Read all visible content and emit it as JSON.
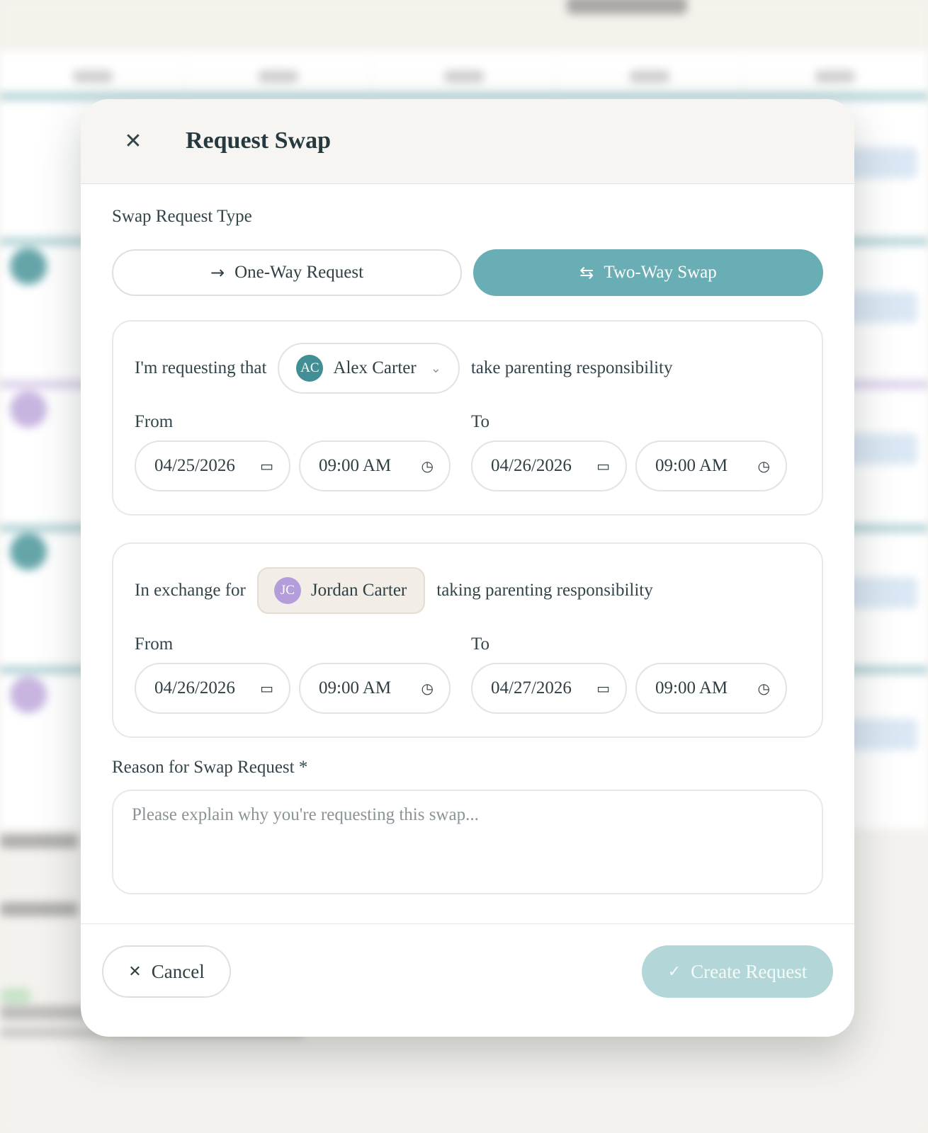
{
  "modal": {
    "title": "Request Swap",
    "close_icon": "close-icon",
    "type_label": "Swap Request Type",
    "types": [
      {
        "label": "One-Way Request",
        "icon": "arrow-right-icon",
        "active": false
      },
      {
        "label": "Two-Way Swap",
        "icon": "swap-arrows-icon",
        "active": true
      }
    ],
    "request": {
      "prefix": "I'm requesting that",
      "person_name": "Alex Carter",
      "person_initials": "AC",
      "suffix": "take parenting responsibility",
      "from_label": "From",
      "to_label": "To",
      "from_date": "04/25/2026",
      "from_time": "09:00 AM",
      "to_date": "04/26/2026",
      "to_time": "09:00 AM"
    },
    "exchange": {
      "prefix": "In exchange for",
      "person_name": "Jordan Carter",
      "person_initials": "JC",
      "suffix": "taking parenting responsibility",
      "from_label": "From",
      "to_label": "To",
      "from_date": "04/26/2026",
      "from_time": "09:00 AM",
      "to_date": "04/27/2026",
      "to_time": "09:00 AM"
    },
    "reason": {
      "label": "Reason for Swap Request *",
      "placeholder": "Please explain why you're requesting this swap...",
      "value": ""
    },
    "footer": {
      "cancel_label": "Cancel",
      "create_label": "Create Request"
    }
  },
  "colors": {
    "accent": "#6aaeb5",
    "accent_disabled": "#b3d6d9",
    "avatar_alex": "#3f8f95",
    "avatar_jordan": "#b39ddb",
    "header_bg": "#f7f5f1"
  }
}
